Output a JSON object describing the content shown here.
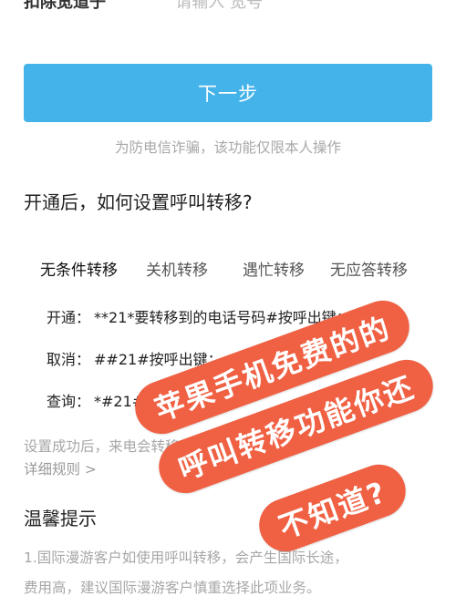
{
  "top_row": {
    "label": "扣除宽道子",
    "value": "请输入 宽号"
  },
  "primary_button_label": "下一步",
  "fraud_notice": "为防电信诈骗，该功能仅限本人操作",
  "question_title": "开通后，如何设置呼叫转移?",
  "tabs": [
    {
      "label": "无条件转移",
      "active": true
    },
    {
      "label": "关机转移",
      "active": false
    },
    {
      "label": "遇忙转移",
      "active": false
    },
    {
      "label": "无应答转移",
      "active": false
    }
  ],
  "codes": [
    {
      "key": "开通：",
      "value": "**21*要转移到的电话号码#按呼出键；"
    },
    {
      "key": "取消：",
      "value": "##21#按呼出键；"
    },
    {
      "key": "查询：",
      "value": "*#21#按呼出键；"
    }
  ],
  "setting_note": "设置成功后，来电会转移到设置电话号码",
  "rules_link": "详细规则 >",
  "tips_title": "温馨提示",
  "tips_lines": [
    "1.国际漫游客户如使用呼叫转移，会产生国际长途，",
    "费用高，建议国际漫游客户慎重选择此项业务。"
  ],
  "overlay_text": [
    "苹果手机免费的的",
    "呼叫转移功能你还",
    "不知道?"
  ],
  "colors": {
    "primary": "#44b3ea",
    "overlay": "#f06043"
  }
}
